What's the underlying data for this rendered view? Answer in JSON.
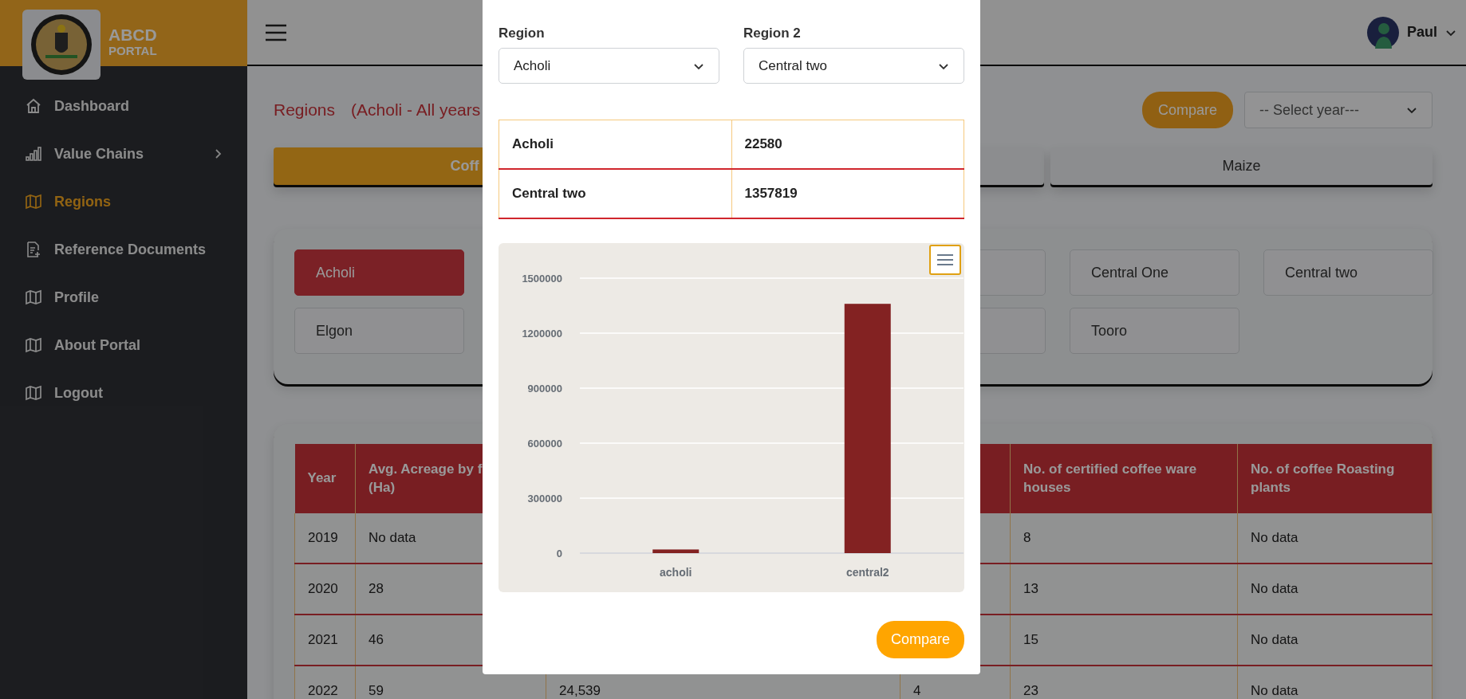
{
  "sidebar": {
    "logo": {
      "title": "ABCD",
      "subtitle": "PORTAL"
    },
    "items": [
      {
        "kind": "home",
        "label": "Dashboard",
        "selected": false,
        "submenu": false
      },
      {
        "kind": "chart",
        "label": "Value Chains",
        "selected": false,
        "submenu": true
      },
      {
        "kind": "map",
        "label": "Regions",
        "selected": true,
        "submenu": false
      },
      {
        "kind": "document",
        "label": "Reference Documents",
        "selected": false,
        "submenu": false
      },
      {
        "kind": "map",
        "label": "Profile",
        "selected": false,
        "submenu": false
      },
      {
        "kind": "map",
        "label": "About Portal",
        "selected": false,
        "submenu": false
      },
      {
        "kind": "map",
        "label": "Logout",
        "selected": false,
        "submenu": false
      }
    ]
  },
  "header": {
    "user": "Paul"
  },
  "page": {
    "title": "Regions",
    "subtitle": "(Acholi - All years",
    "compare_button": "Compare",
    "year_select": {
      "placeholder": "-- Select year---"
    }
  },
  "value_chain_tabs": [
    {
      "kind": "tab",
      "label": "Coff",
      "selected": true
    },
    {
      "kind": "covered"
    },
    {
      "kind": "tab",
      "label": "Maize",
      "selected": false
    }
  ],
  "region_buttons": [
    {
      "kind": "button",
      "label": "Acholi",
      "selected": true
    },
    {
      "kind": "covered"
    },
    {
      "kind": "button",
      "label": "Central One",
      "selected": false
    },
    {
      "kind": "button",
      "label": "Central two",
      "selected": false
    },
    {
      "kind": "button",
      "label": "Elgon",
      "selected": false
    },
    {
      "kind": "covered"
    },
    {
      "kind": "button",
      "label": "Tooro",
      "selected": false
    }
  ],
  "data_table": {
    "columns": [
      "Year",
      "Avg. Acreage by f\n(Ha)",
      null,
      null,
      "No. of certified coffee ware houses",
      "No. of coffee Roasting plants"
    ],
    "rows": [
      [
        "2019",
        "No data",
        null,
        null,
        "8",
        "No data"
      ],
      [
        "2020",
        "28",
        null,
        null,
        "13",
        "No data"
      ],
      [
        "2021",
        "46",
        null,
        null,
        "15",
        "No data"
      ],
      [
        "2022",
        "59",
        "24,539",
        "4",
        "23",
        "No data"
      ]
    ]
  },
  "modal": {
    "region1": {
      "label": "Region",
      "value": "Acholi"
    },
    "region2": {
      "label": "Region 2",
      "value": "Central two"
    },
    "comparison": [
      [
        "Acholi",
        "22580"
      ],
      [
        "Central two",
        "1357819"
      ]
    ],
    "chart_data": {
      "type": "bar",
      "categories": [
        "acholi",
        "central2"
      ],
      "values": [
        20000,
        1360000
      ],
      "ylim": [
        0,
        1500000
      ],
      "yticks": [
        0,
        300000,
        600000,
        900000,
        1200000,
        1500000
      ],
      "grid": true
    },
    "compare_button": "Compare"
  }
}
